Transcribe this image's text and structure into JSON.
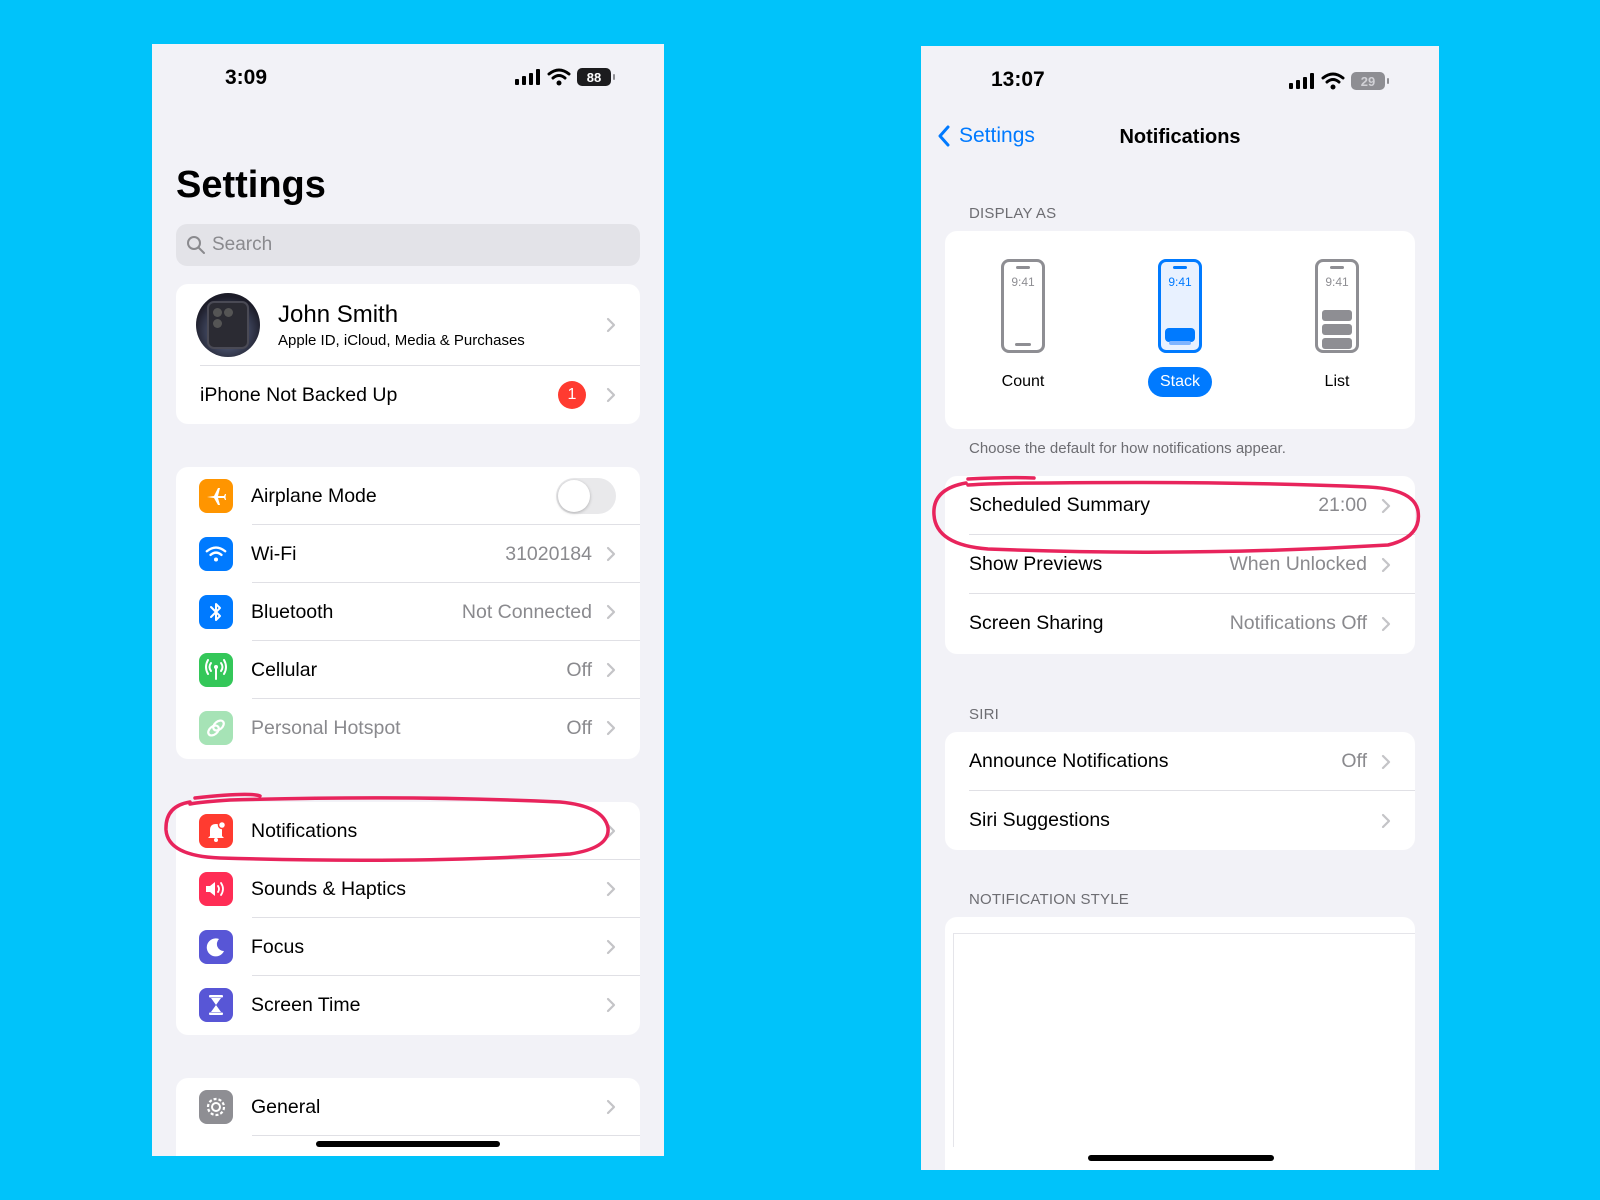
{
  "colors": {
    "background": "#00c3fa",
    "accent": "#007aff",
    "badge": "#ff3b30",
    "annotation": "#e8245c"
  },
  "left": {
    "time": "3:09",
    "battery": "88",
    "title": "Settings",
    "search_placeholder": "Search",
    "profile": {
      "name": "John Smith",
      "subtitle": "Apple ID, iCloud, Media & Purchases"
    },
    "backup": {
      "label": "iPhone Not Backed Up",
      "badge": "1"
    },
    "connectivity": [
      {
        "label": "Airplane Mode",
        "icon": "airplane-icon",
        "color": "#ff9500",
        "toggle": false
      },
      {
        "label": "Wi-Fi",
        "value": "31020184",
        "icon": "wifi-icon",
        "color": "#007aff"
      },
      {
        "label": "Bluetooth",
        "value": "Not Connected",
        "icon": "bluetooth-icon",
        "color": "#007aff"
      },
      {
        "label": "Cellular",
        "value": "Off",
        "icon": "antenna-icon",
        "color": "#34c759"
      },
      {
        "label": "Personal Hotspot",
        "value": "Off",
        "icon": "link-icon",
        "color": "#34c759",
        "dimmed": true
      }
    ],
    "alerts": [
      {
        "label": "Notifications",
        "icon": "bell-icon",
        "color": "#ff3b30"
      },
      {
        "label": "Sounds & Haptics",
        "icon": "speaker-icon",
        "color": "#ff2d55"
      },
      {
        "label": "Focus",
        "icon": "moon-icon",
        "color": "#5856d6"
      },
      {
        "label": "Screen Time",
        "icon": "hourglass-icon",
        "color": "#5856d6"
      }
    ],
    "general": [
      {
        "label": "General",
        "icon": "gear-icon",
        "color": "#8e8e93"
      }
    ]
  },
  "right": {
    "time": "13:07",
    "battery": "29",
    "back_label": "Settings",
    "title": "Notifications",
    "display_as": {
      "header": "DISPLAY AS",
      "options": [
        {
          "label": "Count",
          "clock": "9:41",
          "selected": false
        },
        {
          "label": "Stack",
          "clock": "9:41",
          "selected": true
        },
        {
          "label": "List",
          "clock": "9:41",
          "selected": false
        }
      ],
      "footer": "Choose the default for how notifications appear."
    },
    "summary_rows": [
      {
        "label": "Scheduled Summary",
        "value": "21:00"
      },
      {
        "label": "Show Previews",
        "value": "When Unlocked"
      },
      {
        "label": "Screen Sharing",
        "value": "Notifications Off"
      }
    ],
    "siri": {
      "header": "SIRI",
      "rows": [
        {
          "label": "Announce Notifications",
          "value": "Off"
        },
        {
          "label": "Siri Suggestions",
          "value": ""
        }
      ]
    },
    "style_header": "NOTIFICATION STYLE"
  }
}
